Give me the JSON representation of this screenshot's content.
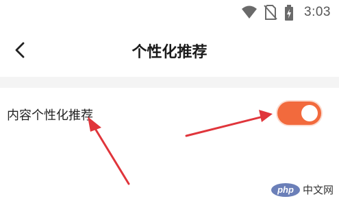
{
  "status_bar": {
    "time": "3:03",
    "icons": [
      "wifi-icon",
      "no-sim-icon",
      "battery-charging-icon"
    ]
  },
  "header": {
    "back_icon": "chevron-left-icon",
    "title": "个性化推荐"
  },
  "settings": {
    "content_personalization": {
      "label": "内容个性化推荐",
      "enabled": true
    }
  },
  "colors": {
    "toggle_on": "#f26a3d",
    "annotation_arrow": "#e0353b",
    "divider_band": "#f4f4f4"
  },
  "watermark": {
    "logo": "php",
    "text": "中文网"
  }
}
